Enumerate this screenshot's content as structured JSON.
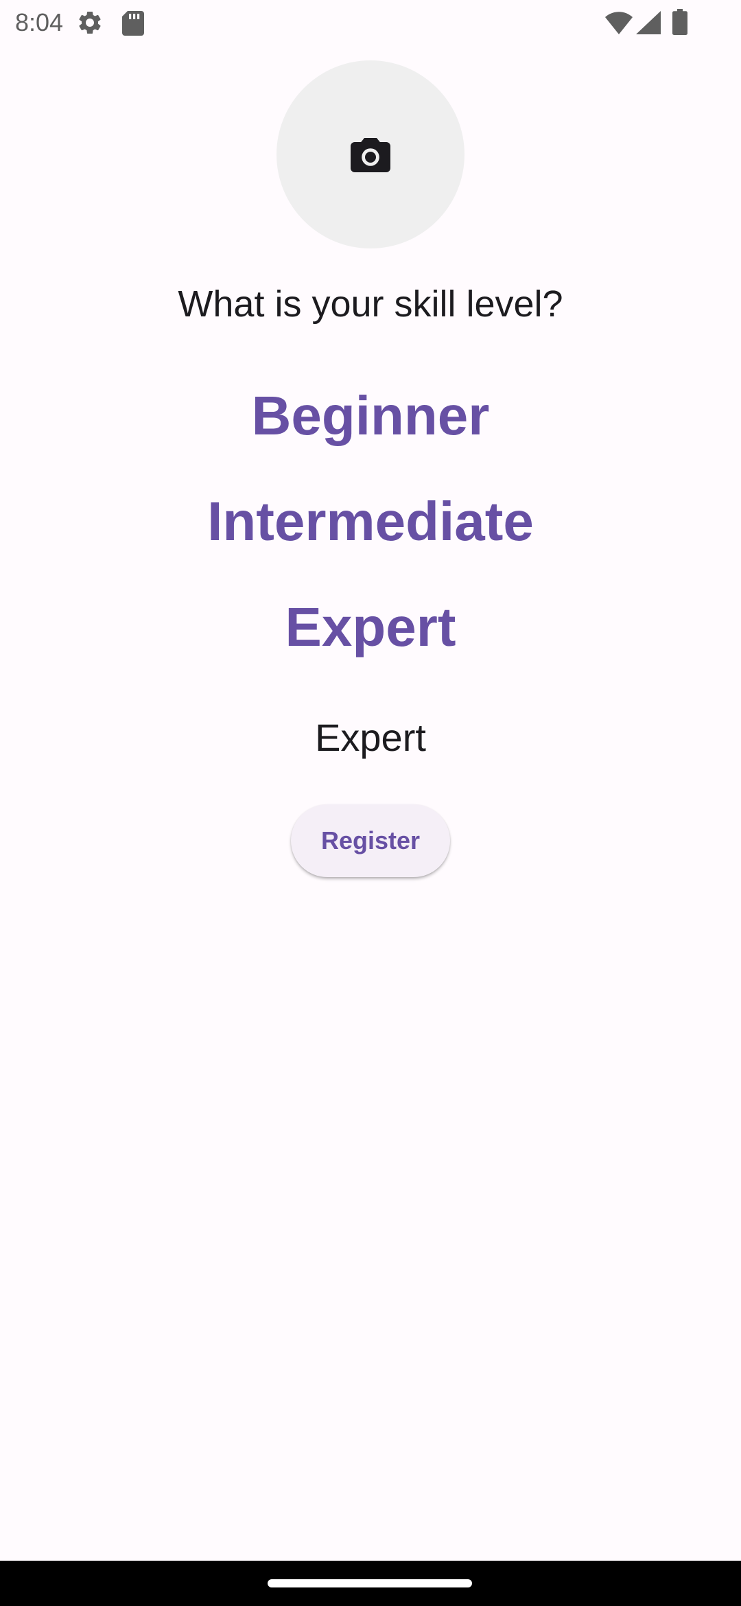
{
  "status_bar": {
    "time": "8:04",
    "icons": [
      "settings-icon",
      "sd-card-icon",
      "wifi-icon",
      "cell-signal-icon",
      "battery-icon"
    ]
  },
  "avatar": {
    "icon": "camera-icon"
  },
  "question": "What is your skill level?",
  "levels": [
    {
      "label": "Beginner"
    },
    {
      "label": "Intermediate"
    },
    {
      "label": "Expert"
    }
  ],
  "selected_level": "Expert",
  "register_button": {
    "label": "Register"
  },
  "colors": {
    "accent": "#6750a4",
    "background": "#fffbfe",
    "avatar_bg": "#efefef",
    "button_bg": "#f5eff7",
    "text": "#1c1b1f"
  }
}
